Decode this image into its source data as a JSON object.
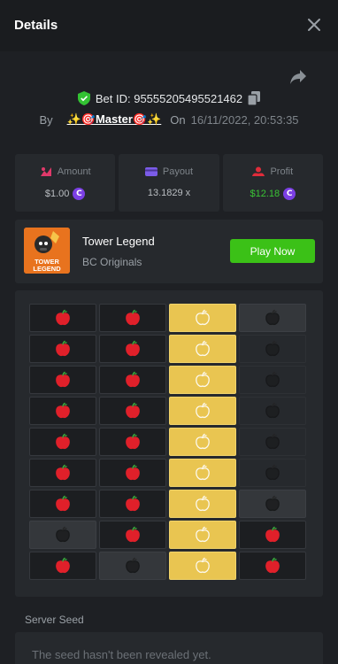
{
  "header": {
    "title": "Details",
    "close_icon": "close-icon"
  },
  "share_icon": "share-icon",
  "bet": {
    "id_text": "Bet ID: 95555205495521462",
    "by_label": "By",
    "username": "✨🎯Master🎯✨",
    "on_label": "On",
    "date": "16/11/2022, 20:53:35"
  },
  "stats": {
    "amount": {
      "label": "Amount",
      "value": "$1.00"
    },
    "payout": {
      "label": "Payout",
      "value": "13.1829 x"
    },
    "profit": {
      "label": "Profit",
      "value": "$12.18"
    }
  },
  "game": {
    "name": "Tower Legend",
    "provider": "BC Originals",
    "play_label": "Play Now",
    "thumb_text_1": "TOWER",
    "thumb_text_2": "LEGEND"
  },
  "board": {
    "rows": [
      [
        "apple",
        "apple",
        "gold",
        "dim"
      ],
      [
        "apple",
        "apple",
        "gold",
        "dark"
      ],
      [
        "apple",
        "apple",
        "gold",
        "dark"
      ],
      [
        "apple",
        "apple",
        "gold",
        "dark"
      ],
      [
        "apple",
        "apple",
        "gold",
        "dark"
      ],
      [
        "apple",
        "apple",
        "gold",
        "dark"
      ],
      [
        "apple",
        "apple",
        "gold",
        "dim"
      ],
      [
        "dim",
        "apple",
        "gold",
        "apple"
      ],
      [
        "apple",
        "dim",
        "gold",
        "apple"
      ]
    ]
  },
  "seed": {
    "label": "Server Seed",
    "text": "The seed hasn't been revealed yet."
  },
  "colors": {
    "accent_green": "#3bc117",
    "gold": "#e9c551",
    "coin_purple": "#7b3fe4",
    "apple_red": "#e0202a"
  }
}
